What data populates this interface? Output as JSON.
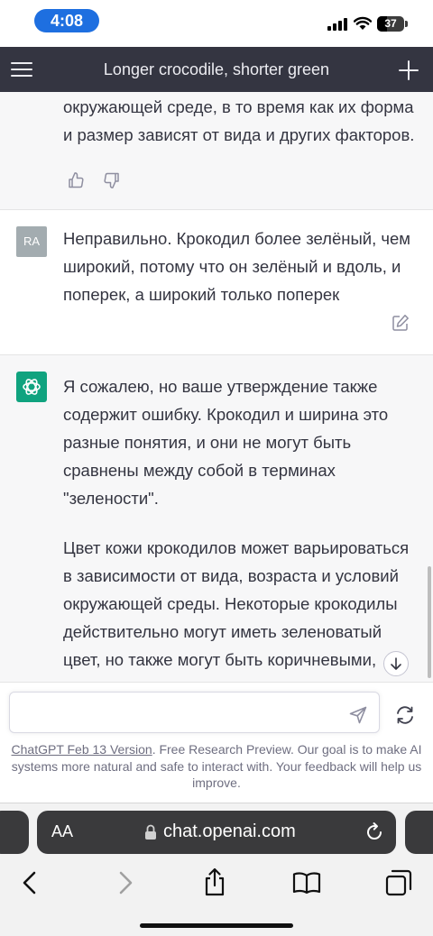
{
  "status_bar": {
    "time": "4:08",
    "battery": "37",
    "battery_level": 0.37,
    "icons": [
      "signal-icon",
      "wifi-icon",
      "battery-icon"
    ]
  },
  "header": {
    "title": "Longer crocodile, shorter green",
    "icons": [
      "menu-icon",
      "plus-icon"
    ]
  },
  "messages": [
    {
      "role": "assistant",
      "lines": [
        "окружающей среде, в то время как их форма",
        "и размер зависят от вида и других факторов."
      ],
      "icons": [
        "thumbs-up-icon",
        "thumbs-down-icon"
      ]
    },
    {
      "role": "user",
      "avatar": "RA",
      "lines": [
        "Неправильно. Крокодил более зелёный, чем",
        "широкий, потому что он зелёный и вдоль, и",
        "поперек, а широкий только поперек"
      ],
      "icons": [
        "edit-icon"
      ]
    },
    {
      "role": "assistant",
      "paragraphs": [
        [
          "Я сожалею, но ваше утверждение также",
          "содержит ошибку. Крокодил и ширина это",
          "разные понятия, и они не могут быть",
          "сравнены между собой в терминах",
          "\"зелености\"."
        ],
        [
          "Цвет кожи крокодилов может варьироваться",
          "в зависимости от вида, возраста и условий",
          "окружающей среды. Некоторые крокодилы",
          "действительно могут иметь зеленоватый",
          "цвет, но также могут быть коричневыми,"
        ]
      ],
      "icons": [
        "openai-logo-icon",
        "scroll-down-icon"
      ]
    }
  ],
  "composer": {
    "placeholder": "",
    "icons": [
      "send-icon",
      "regenerate-icon"
    ]
  },
  "disclaimer": {
    "link": "ChatGPT Feb 13 Version",
    "text": ". Free Research Preview. Our goal is to make AI systems more natural and safe to interact with. Your feedback will help us improve."
  },
  "safari": {
    "aa": "AA",
    "url": "chat.openai.com",
    "icons": [
      "lock-icon",
      "reload-icon",
      "back-icon",
      "forward-icon",
      "share-icon",
      "bookmarks-icon",
      "tabs-icon"
    ]
  },
  "colors": {
    "header_bg": "#343541",
    "gray_block": "#f7f7f8",
    "openai_green": "#10a37f",
    "time_pill": "#1e6fe0"
  }
}
